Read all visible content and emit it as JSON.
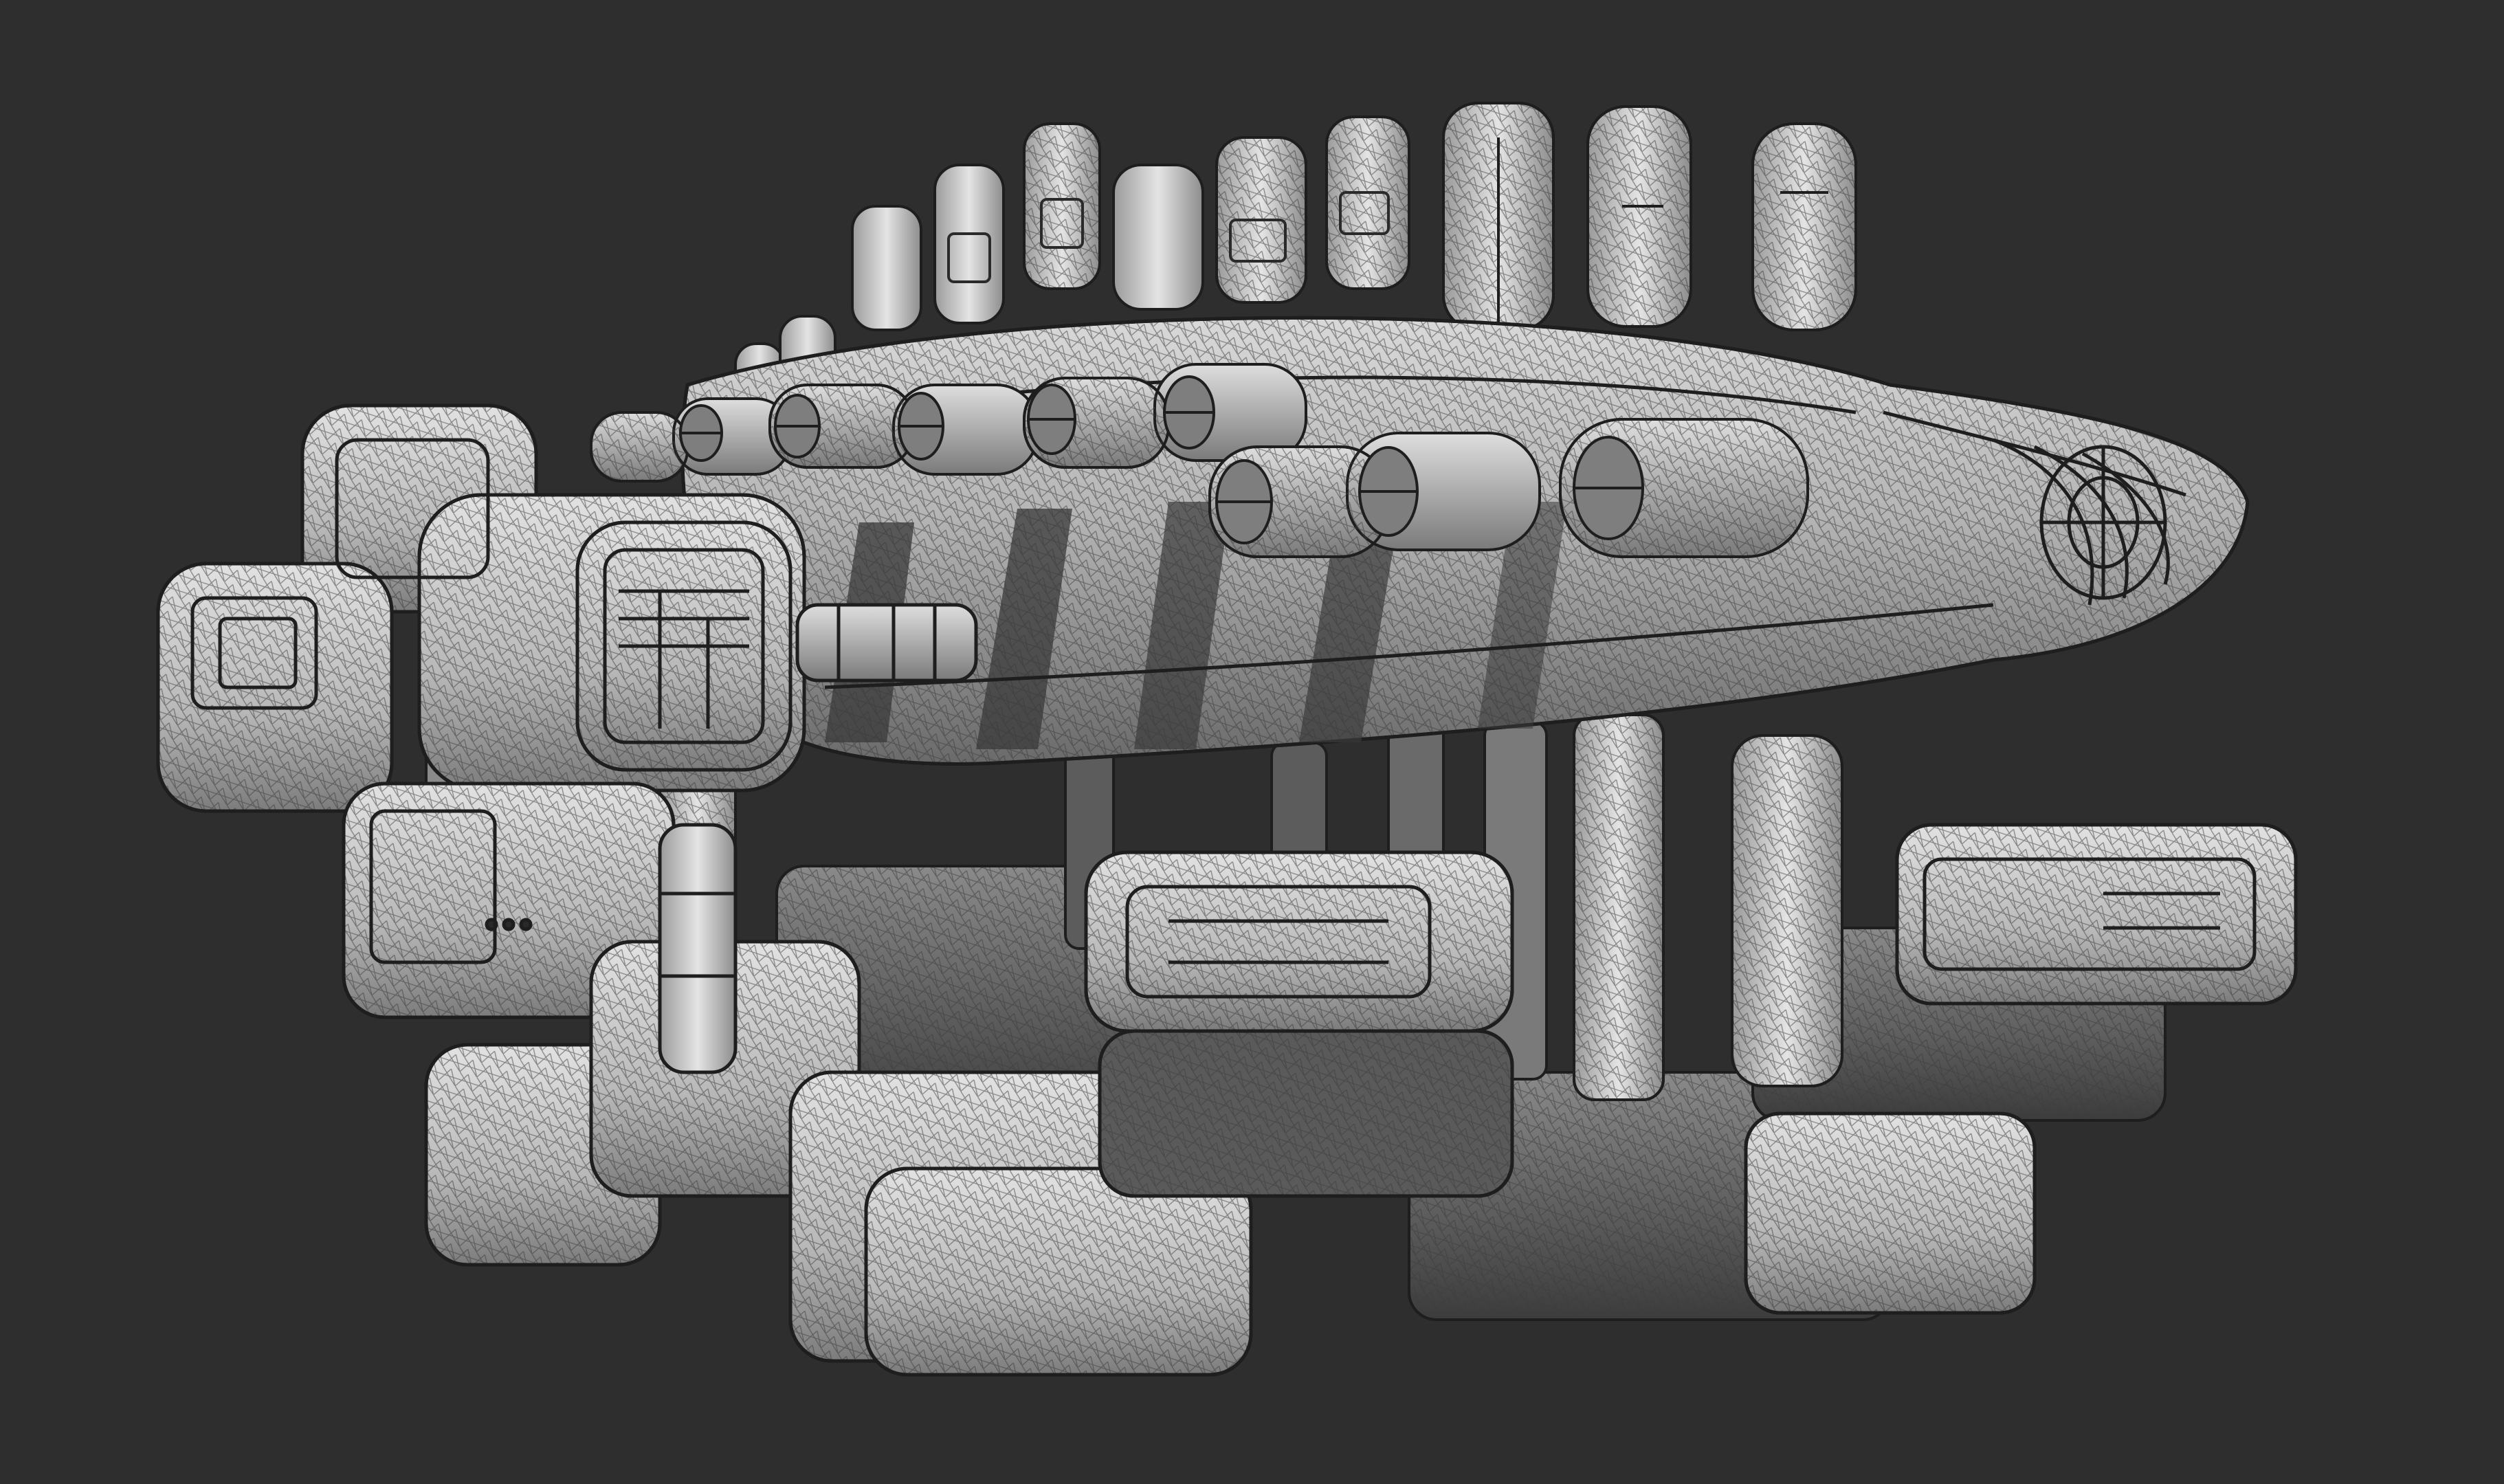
{
  "viewport": {
    "background": "#2e2e2e",
    "wire_color": "#5c5c5c",
    "dark_line": "#1e1e1e",
    "highlight": "#dcdcdc",
    "mid": "#a8a8a8",
    "shadow": "#4a4a4a"
  },
  "subject": {
    "icon": "spaceship-wireframe-model"
  }
}
